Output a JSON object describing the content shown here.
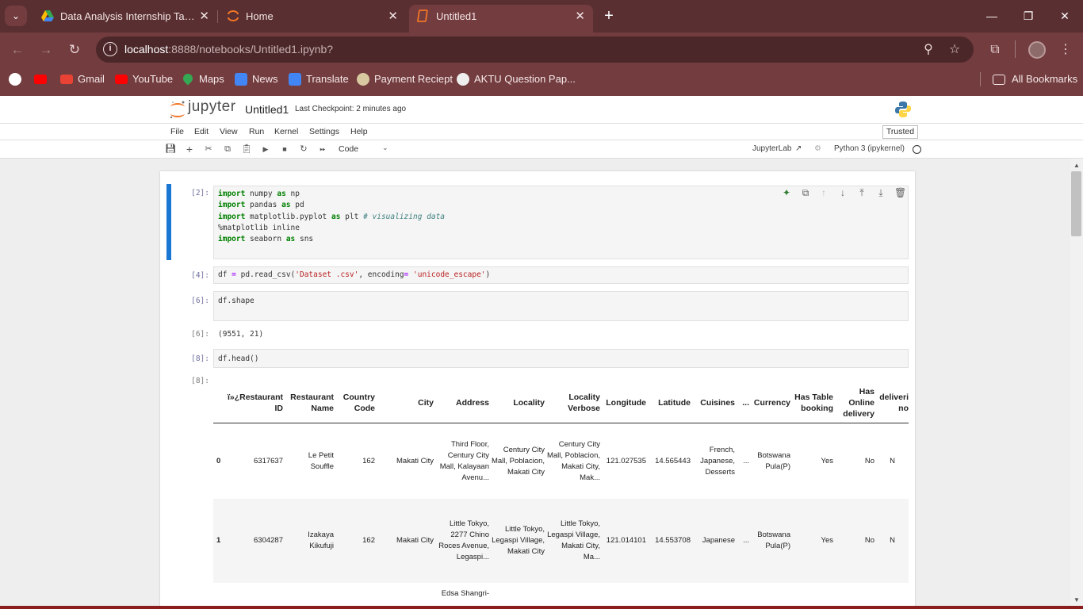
{
  "browser": {
    "tabs": [
      {
        "title": "Data Analysis Internship Task .p",
        "favicon": "google-drive-icon"
      },
      {
        "title": "Home",
        "favicon": "jupyter-icon"
      },
      {
        "title": "Untitled1",
        "favicon": "notebook-icon",
        "active": true
      }
    ],
    "url_host": "localhost",
    "url_rest": ":8888/notebooks/Untitled1.ipynb?",
    "bookmarks": [
      {
        "label": "",
        "icon": "google-icon"
      },
      {
        "label": "",
        "icon": "youtube-icon"
      },
      {
        "label": "Gmail",
        "icon": "gmail-icon"
      },
      {
        "label": "YouTube",
        "icon": "youtube-icon"
      },
      {
        "label": "Maps",
        "icon": "maps-icon"
      },
      {
        "label": "News",
        "icon": "news-icon"
      },
      {
        "label": "Translate",
        "icon": "translate-icon"
      },
      {
        "label": "Payment Reciept",
        "icon": "site-icon"
      },
      {
        "label": "AKTU Question Pap...",
        "icon": "site-icon"
      }
    ],
    "all_bookmarks": "All Bookmarks"
  },
  "jupyter": {
    "brand": "jupyter",
    "notebook_name": "Untitled1",
    "checkpoint": "Last Checkpoint: 2 minutes ago",
    "menu": [
      "File",
      "Edit",
      "View",
      "Run",
      "Kernel",
      "Settings",
      "Help"
    ],
    "trusted": "Trusted",
    "cell_type": "Code",
    "jupyterlab": "JupyterLab",
    "kernel": "Python 3 (ipykernel)"
  },
  "cells": {
    "c1": {
      "prompt": "[2]:",
      "lines": [
        "import numpy as np",
        "import pandas as pd",
        "import matplotlib.pyplot as plt # visualizing data",
        "%matplotlib inline",
        "import seaborn as sns"
      ]
    },
    "c2": {
      "prompt": "[4]:",
      "code": "df = pd.read_csv('Dataset .csv', encoding= 'unicode_escape')"
    },
    "c3": {
      "prompt": "[6]:",
      "code": "df.shape",
      "out_prompt": "[6]:",
      "output": "(9551, 21)"
    },
    "c4": {
      "prompt": "[8]:",
      "code": "df.head()",
      "out_prompt": "[8]:"
    }
  },
  "dataframe": {
    "columns": [
      "ï»¿Restaurant ID",
      "Restaurant Name",
      "Country Code",
      "City",
      "Address",
      "Locality",
      "Locality Verbose",
      "Longitude",
      "Latitude",
      "Cuisines",
      "...",
      "Currency",
      "Has Table booking",
      "Has Online delivery",
      "deliveri no"
    ],
    "rows": [
      {
        "idx": "0",
        "cells": [
          "6317637",
          "Le Petit Souffle",
          "162",
          "Makati City",
          "Third Floor, Century City Mall, Kalayaan Avenu...",
          "Century City Mall, Poblacion, Makati City",
          "Century City Mall, Poblacion, Makati City, Mak...",
          "121.027535",
          "14.565443",
          "French, Japanese, Desserts",
          "...",
          "Botswana Pula(P)",
          "Yes",
          "No",
          "N"
        ]
      },
      {
        "idx": "1",
        "cells": [
          "6304287",
          "Izakaya Kikufuji",
          "162",
          "Makati City",
          "Little Tokyo, 2277 Chino Roces Avenue, Legaspi...",
          "Little Tokyo, Legaspi Village, Makati City",
          "Little Tokyo, Legaspi Village, Makati City, Ma...",
          "121.014101",
          "14.553708",
          "Japanese",
          "...",
          "Botswana Pula(P)",
          "Yes",
          "No",
          "N"
        ]
      },
      {
        "idx": "",
        "cells": [
          "",
          "",
          "",
          "",
          "Edsa Shangri-",
          "",
          "",
          "",
          "",
          "",
          "",
          "",
          "",
          "",
          ""
        ]
      }
    ]
  }
}
